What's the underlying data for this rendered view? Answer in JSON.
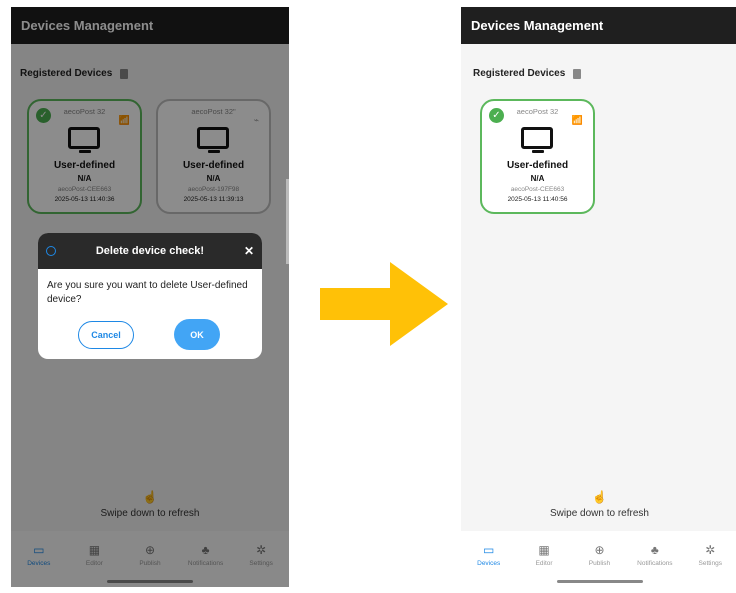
{
  "app_title": "Devices Management",
  "section_title": "Registered Devices",
  "before": {
    "devices": [
      {
        "name": "aecoPost 32",
        "title": "User-defined",
        "status": "N/A",
        "id": "aecoPost-CEE663",
        "date": "2025-05-13 11:40:36",
        "state": "selected"
      },
      {
        "name": "aecoPost 32\"",
        "title": "User-defined",
        "status": "N/A",
        "id": "aecoPost-197F98",
        "date": "2025-05-13 11:39:13",
        "state": "disconnected"
      }
    ],
    "dialog": {
      "title": "Delete device check!",
      "message": "Are you sure you want to delete  User-defined device?",
      "cancel_label": "Cancel",
      "ok_label": "OK"
    }
  },
  "after": {
    "devices": [
      {
        "name": "aecoPost 32",
        "title": "User-defined",
        "status": "N/A",
        "id": "aecoPost-CEE663",
        "date": "2025-05-13 11:40:56",
        "state": "selected"
      }
    ]
  },
  "refresh_hint": "Swipe down to refresh",
  "nav": [
    {
      "label": "Devices",
      "icon": "devices-icon",
      "active": true
    },
    {
      "label": "Editor",
      "icon": "editor-icon",
      "active": false
    },
    {
      "label": "Publish",
      "icon": "publish-icon",
      "active": false
    },
    {
      "label": "Notifications",
      "icon": "bell-icon",
      "active": false
    },
    {
      "label": "Settings",
      "icon": "gear-icon",
      "active": false
    }
  ],
  "colors": {
    "accent": "#1e88e5",
    "connected": "#4caf50",
    "arrow": "#ffc107",
    "appbar": "#1f1f1f"
  }
}
